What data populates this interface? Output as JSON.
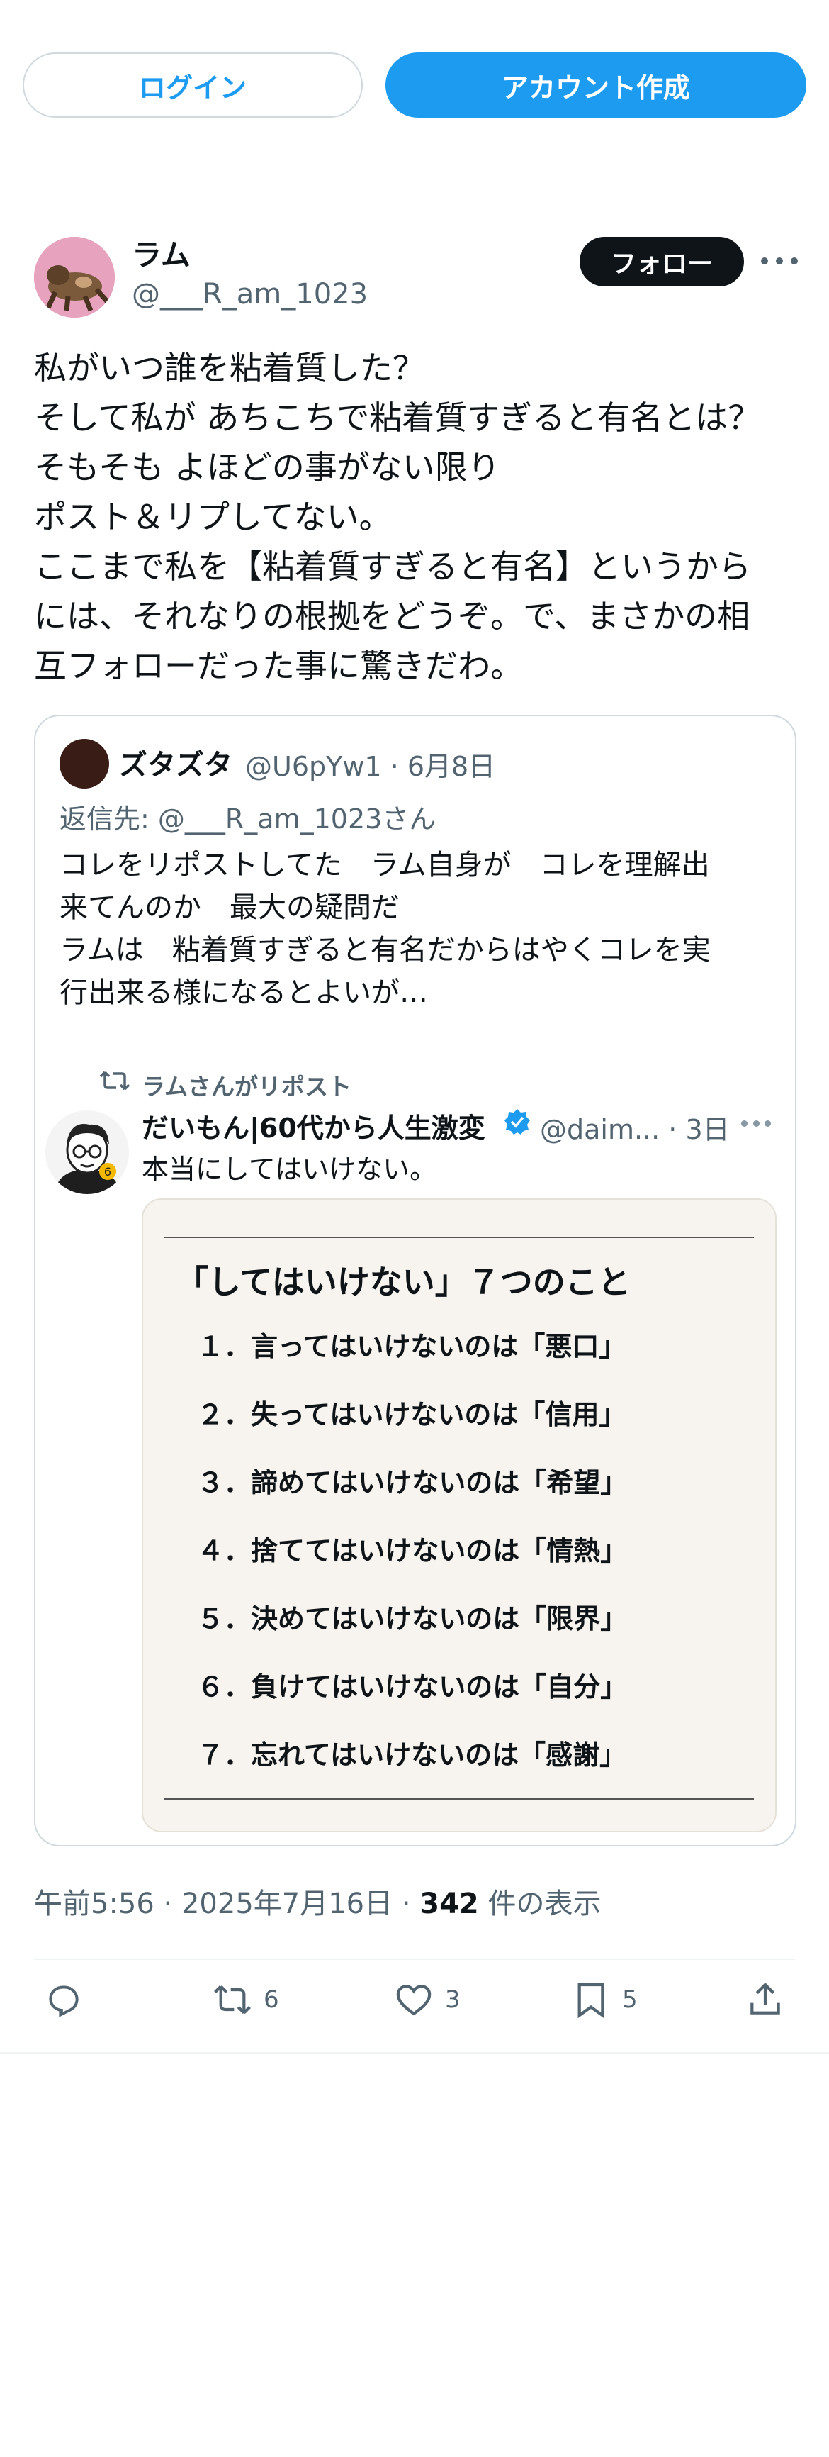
{
  "top_buttons": {
    "login": "ログイン",
    "signup": "アカウント作成"
  },
  "post": {
    "author_name": "ラム",
    "author_handle": "@___R_am_1023",
    "follow_label": "フォロー",
    "text_lines": [
      "私がいつ誰を粘着質した？",
      "そして私が あちこちで粘着質すぎると有名とは？",
      "そもそも よほどの事がない限り",
      "ポスト＆リプしてない。",
      "ここまで私を【粘着質すぎると有名】というから",
      "には、それなりの根拠をどうぞ。で、まさかの相",
      "互フォローだった事に驚きだわ。"
    ],
    "timestamp_prefix": "午前5:56 · 2025年7月16日 · ",
    "view_count": "342",
    "view_suffix": " 件の表示"
  },
  "quote": {
    "author_name": "ズタズタ",
    "handle_date": "@U6pYw1 · 6月8日",
    "reply_to": "返信先: @___R_am_1023さん",
    "text_lines": [
      "コレをリポストしてた　ラム自身が　コレを理解出",
      "来てんのか　最大の疑問だ",
      "ラムは　粘着質すぎると有名だからはやくコレを実",
      "行出来る様になるとよいが…"
    ],
    "repost_label": "ラムさんがリポスト",
    "reposted": {
      "author_name": "だいもん|60代から人生激変",
      "handle_date": "@daim... · 3日",
      "text": "本当にしてはいけない。",
      "image_title": "「してはいけない」７つのこと",
      "image_items": [
        "１．言ってはいけないのは「悪口」",
        "２．失ってはいけないのは「信用」",
        "３．諦めてはいけないのは「希望」",
        "４．捨ててはいけないのは「情熱」",
        "５．決めてはいけないのは「限界」",
        "６．負けてはいけないのは「自分」",
        "７．忘れてはいけないのは「感謝」"
      ]
    }
  },
  "actions": {
    "reply": "",
    "repost": "6",
    "like": "3",
    "bookmark": "5"
  },
  "colors": {
    "accent": "#1d9bf0",
    "text": "#0f1419",
    "secondary": "#536471",
    "border": "#cfd9de"
  }
}
